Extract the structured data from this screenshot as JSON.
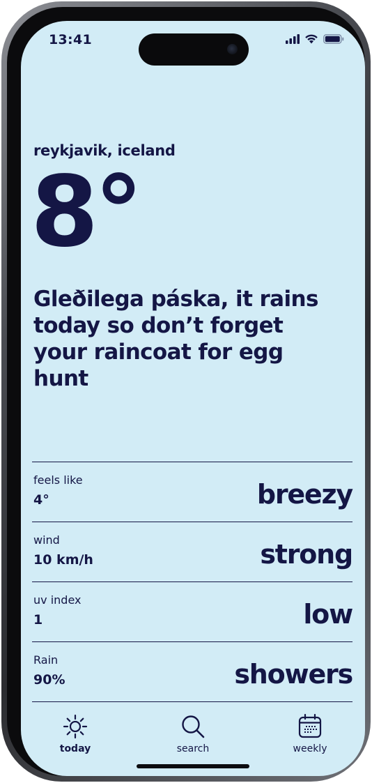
{
  "status_bar": {
    "time": "13:41",
    "signal_icon": "cellular-signal-icon",
    "wifi_icon": "wifi-icon",
    "battery_icon": "battery-icon"
  },
  "weather": {
    "location": "reykjavik, iceland",
    "temperature": "8°",
    "headline": "Gleðilega páska, it rains today so don’t forget your raincoat for egg hunt"
  },
  "metrics": [
    {
      "label": "feels like",
      "value": "4°",
      "description": "breezy"
    },
    {
      "label": "wind",
      "value": "10 km/h",
      "description": "strong"
    },
    {
      "label": "uv index",
      "value": "1",
      "description": "low"
    },
    {
      "label": "Rain",
      "value": "90%",
      "description": "showers"
    }
  ],
  "tabs": [
    {
      "label": "today",
      "icon": "sun-icon",
      "active": true
    },
    {
      "label": "search",
      "icon": "search-icon",
      "active": false
    },
    {
      "label": "weekly",
      "icon": "calendar-icon",
      "active": false
    }
  ],
  "colors": {
    "background": "#d2ecf6",
    "foreground": "#141645"
  }
}
